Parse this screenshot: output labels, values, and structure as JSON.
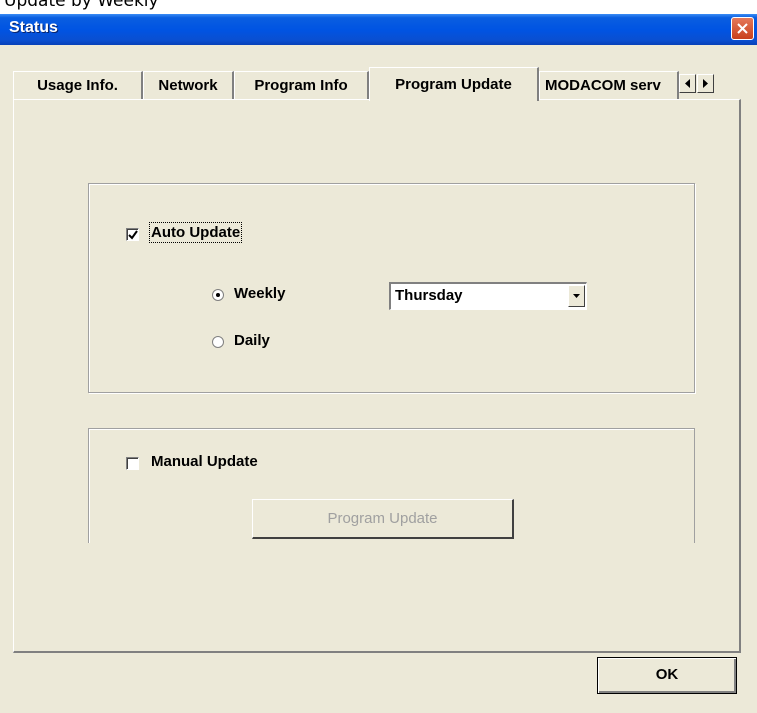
{
  "caption_top": "Update by Weekly",
  "window": {
    "title": "Status"
  },
  "tabs": [
    {
      "label": "Usage Info."
    },
    {
      "label": "Network"
    },
    {
      "label": "Program Info"
    },
    {
      "label": "Program Update"
    },
    {
      "label": "MODACOM serv"
    }
  ],
  "active_tab": "Program Update",
  "auto_update": {
    "label": "Auto Update",
    "checked": true,
    "weekly_label": "Weekly",
    "daily_label": "Daily",
    "selected_frequency": "Weekly",
    "day_select": {
      "value": "Thursday"
    }
  },
  "manual_update": {
    "label": "Manual Update",
    "checked": false,
    "button_label": "Program Update",
    "button_enabled": false
  },
  "ok_button": {
    "label": "OK"
  },
  "colors": {
    "titlebar": "#0054e3",
    "face": "#ece9d8",
    "close": "#c8401c"
  }
}
